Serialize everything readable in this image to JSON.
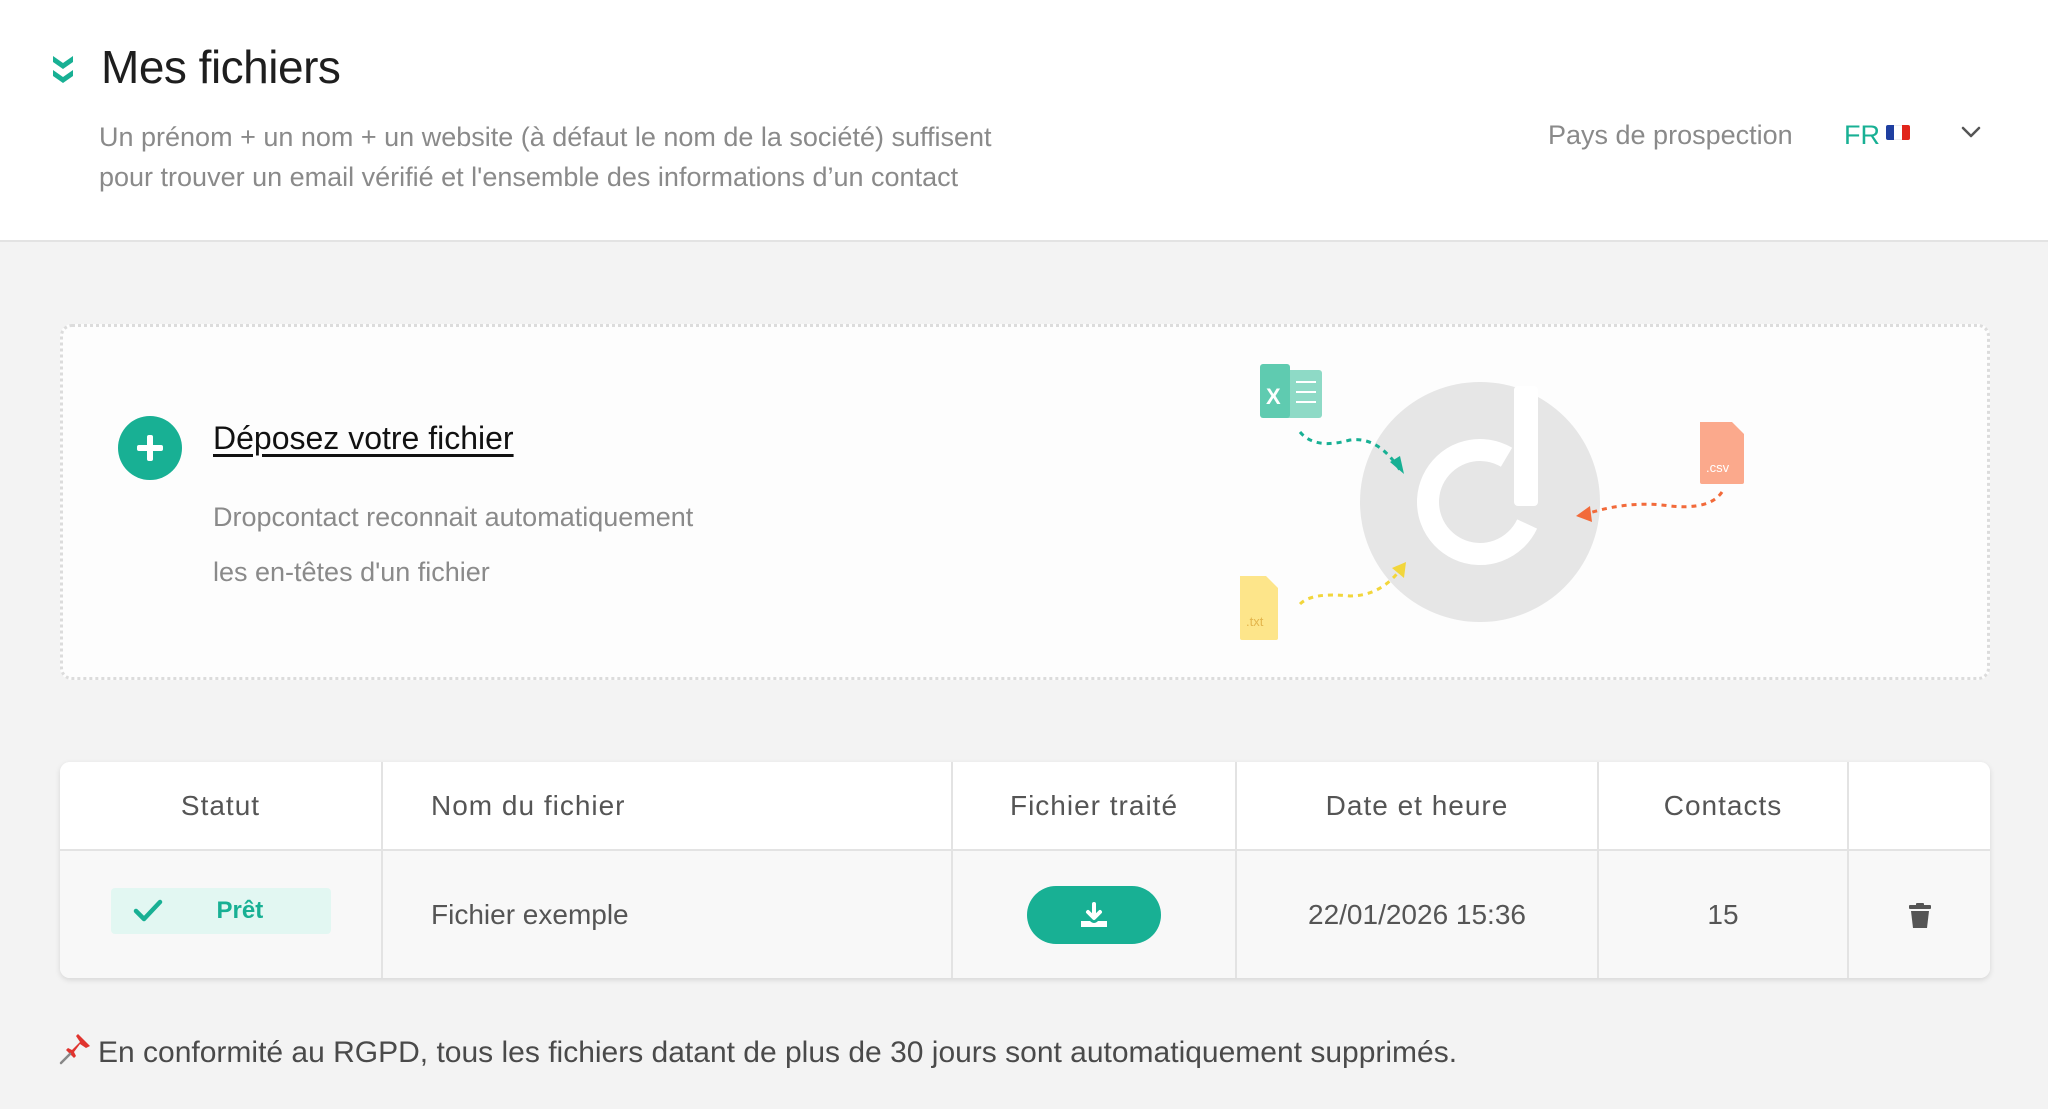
{
  "header": {
    "title": "Mes fichiers",
    "subtitle_line1": "Un prénom + un nom + un website (à défaut le nom de la société) suffisent",
    "subtitle_line2": "pour trouver un email vérifié et l'ensemble des informations d’un contact",
    "country_label": "Pays de prospection",
    "country_code": "FR"
  },
  "dropzone": {
    "title": "Déposez votre fichier",
    "desc_line1": "Dropcontact reconnait automatiquement",
    "desc_line2": "les en-têtes d'un fichier",
    "file_labels": {
      "excel": "X",
      "csv": ".csv",
      "txt": ".txt"
    }
  },
  "table": {
    "headers": [
      "Statut",
      "Nom du fichier",
      "Fichier traité",
      "Date et heure",
      "Contacts",
      ""
    ],
    "rows": [
      {
        "status": "Prêt",
        "name": "Fichier exemple",
        "datetime": "22/01/2026 15:36",
        "contacts": "15"
      }
    ]
  },
  "notice": "En conformité au RGPD, tous les fichiers datant de plus de 30 jours sont automatiquement supprimés.",
  "colors": {
    "accent": "#18b094",
    "csv": "#fba98c",
    "txt": "#fde58a",
    "excel": "#5fcbb0"
  }
}
